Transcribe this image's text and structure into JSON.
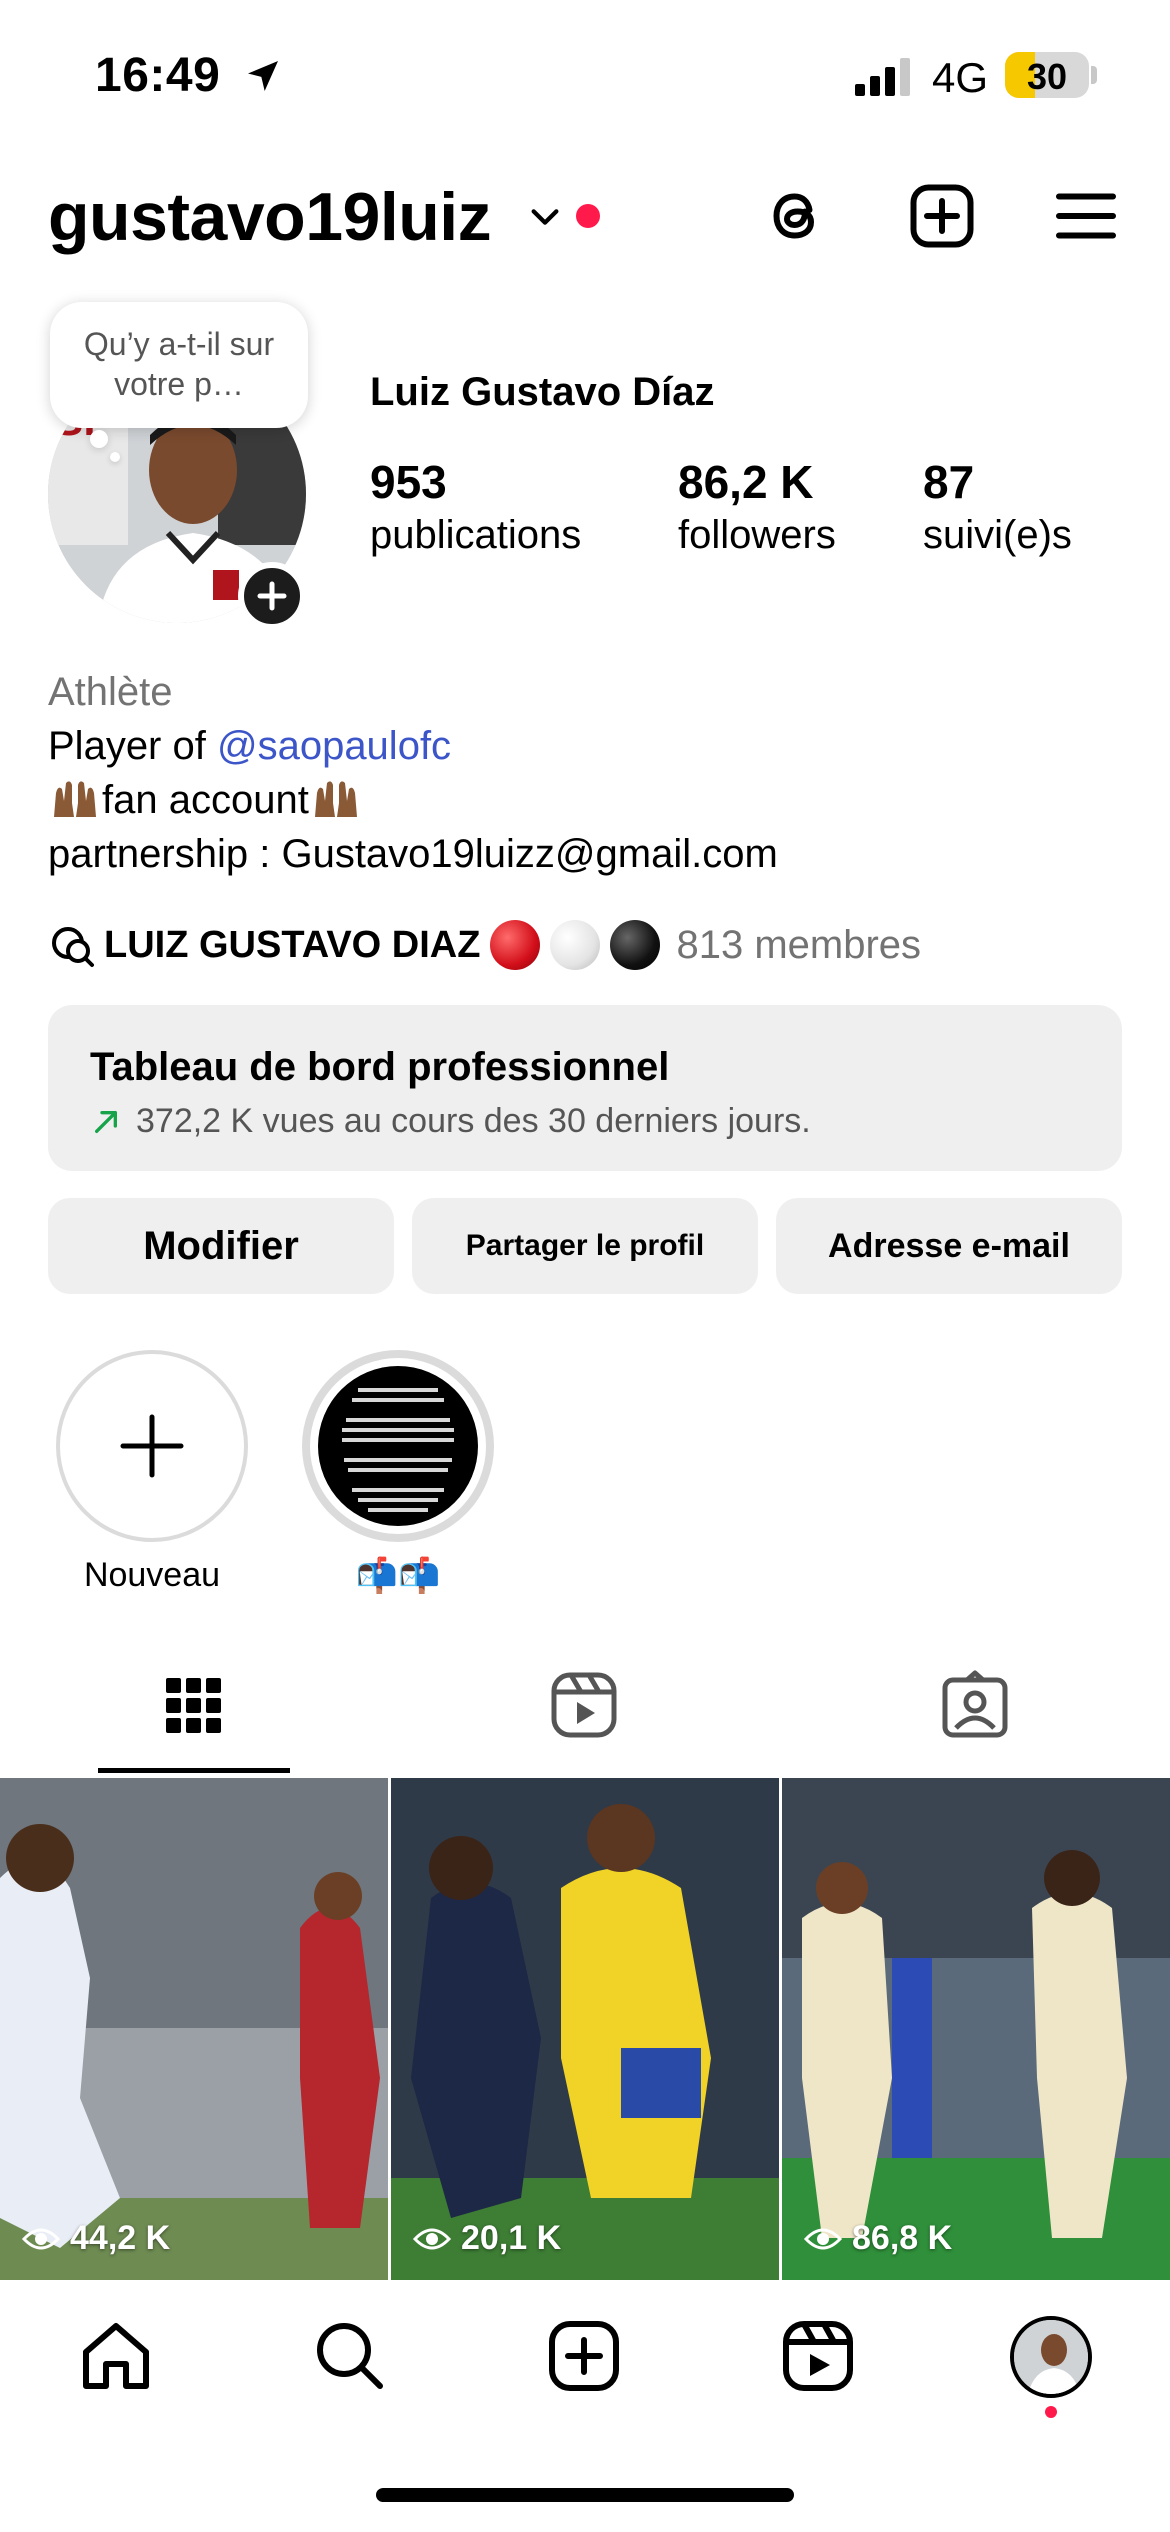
{
  "status_bar": {
    "time": "16:49",
    "network": "4G",
    "battery": "30"
  },
  "header": {
    "username": "gustavo19luiz"
  },
  "profile": {
    "note": "Qu’y a-t-il sur votre p…",
    "full_name": "Luiz Gustavo Díaz",
    "stats": [
      {
        "value": "953",
        "label": "publications"
      },
      {
        "value": "86,2 K",
        "label": "followers"
      },
      {
        "value": "87",
        "label": "suivi(e)s"
      }
    ],
    "category": "Athlète",
    "bio_line1_prefix": "Player of ",
    "bio_mention": "@saopaulofc",
    "bio_line2": "fan account",
    "bio_line3": "partnership : Gustavo19luizz@gmail.com",
    "channel_name": "LUIZ GUSTAVO DIAZ",
    "channel_members": "813 membres"
  },
  "dashboard": {
    "title": "Tableau de bord professionnel",
    "subtitle": "372,2 K vues au cours des 30 derniers jours."
  },
  "buttons": {
    "edit": "Modifier",
    "share": "Partager le profil",
    "email": "Adresse e-mail"
  },
  "highlights": [
    {
      "label": "Nouveau"
    },
    {
      "label": "📬📬"
    }
  ],
  "posts": [
    {
      "views": "44,2 K"
    },
    {
      "views": "20,1 K"
    },
    {
      "views": "86,8 K"
    }
  ],
  "colors": {
    "accent_red": "#ff1a4b",
    "link_blue": "#3c55c8",
    "battery_yellow": "#f6c800"
  }
}
